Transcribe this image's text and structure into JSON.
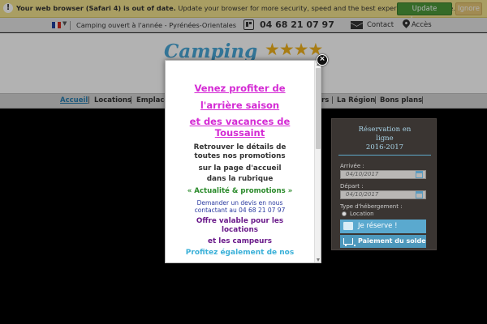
{
  "browser_warning": {
    "message_bold": "Your web browser (Safari 4) is out of date.",
    "message_rest": " Update your browser for more security, speed and the best experience on this site.",
    "update_label": "Update browser",
    "ignore_label": "Ignore"
  },
  "topbar": {
    "tagline": "Camping ouvert à l'année - Pyrénées-Orientales",
    "phone": "04 68 21 07 97",
    "contact_label": "Contact",
    "access_label": "Accès"
  },
  "header": {
    "logo_text": "Camping",
    "stars": "★★★★"
  },
  "nav": {
    "items": [
      {
        "label": "Accueil",
        "active": true
      },
      {
        "label": "Locations"
      },
      {
        "label": "Emplace"
      },
      {
        "label": "rs"
      },
      {
        "label": "La Région"
      },
      {
        "label": "Bons plans"
      }
    ]
  },
  "reservation": {
    "title_line1": "Réservation en",
    "title_line2": "ligne",
    "season": "2016-2017",
    "arrival_label": "Arrivée :",
    "arrival_value": "04/10/2017",
    "departure_label": "Départ :",
    "departure_value": "04/10/2017",
    "type_label": "Type d'hébergement :",
    "type_option": "Location",
    "reserve_label": "Je réserve !",
    "pay_label": "Paiement du solde"
  },
  "popup": {
    "title_line1": "Venez profiter de",
    "title_line2": "l'arrière saison",
    "title_line3": "et des vacances de",
    "title_line4": "Toussaint",
    "body_line1": "Retrouver le détails  de",
    "body_line2": "toutes nos promotions",
    "body_line3": "sur la page d'accueil",
    "body_line4": "dans la rubrique",
    "rubric": "« Actualité & promotions »",
    "quote_line1": "Demander un devis en nous",
    "quote_line2": "contactant au 04 68 21 07 97",
    "offer_line1": "Offre valable pour les",
    "offer_line2": "locations",
    "offer_line3": "et les campeurs",
    "also": "Profitez également de nos",
    "close_label": "×"
  },
  "colors": {
    "accent": "#5aa9cf",
    "popup_title": "#d42ad4",
    "promo_green": "#2a8a2a",
    "update_button": "#4d9a3a"
  }
}
